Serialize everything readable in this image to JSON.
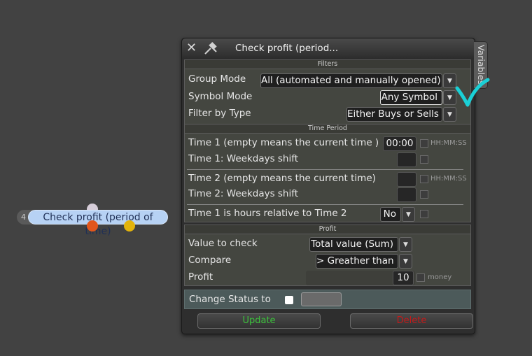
{
  "node": {
    "index": "4",
    "label": "Check profit (period of time)"
  },
  "dialog": {
    "title": "Check profit (period...",
    "side_tab": "Variables",
    "filters": {
      "header": "Filters",
      "group_mode_label": "Group Mode",
      "group_mode_value": "All (automated and manually opened)",
      "symbol_mode_label": "Symbol Mode",
      "symbol_mode_value": "Any Symbol",
      "filter_type_label": "Filter by Type",
      "filter_type_value": "Either Buys or Sells"
    },
    "time_period": {
      "header": "Time Period",
      "time1_label": "Time 1 (empty means the current time )",
      "time1_value": "00:00",
      "time1_hint": "HH:MM:SS",
      "time1_shift_label": "Time 1: Weekdays shift",
      "time2_label": "Time 2 (empty means the current time)",
      "time2_hint": "HH:MM:SS",
      "time2_shift_label": "Time 2: Weekdays shift",
      "relative_label": "Time 1 is hours relative to Time 2",
      "relative_value": "No"
    },
    "profit": {
      "header": "Profit",
      "value_label": "Value to check",
      "value_value": "Total value (Sum)",
      "compare_label": "Compare",
      "compare_value": "> Greather than",
      "profit_label": "Profit",
      "profit_value": "10",
      "profit_unit": "money"
    },
    "status": {
      "label": "Change Status to"
    },
    "buttons": {
      "update": "Update",
      "delete": "Delete"
    }
  },
  "colors": {
    "node_fill": "#b7d2f4",
    "update_text": "#3cc23c",
    "delete_text": "#c41a1a",
    "annotation": "#1ad0d6"
  }
}
